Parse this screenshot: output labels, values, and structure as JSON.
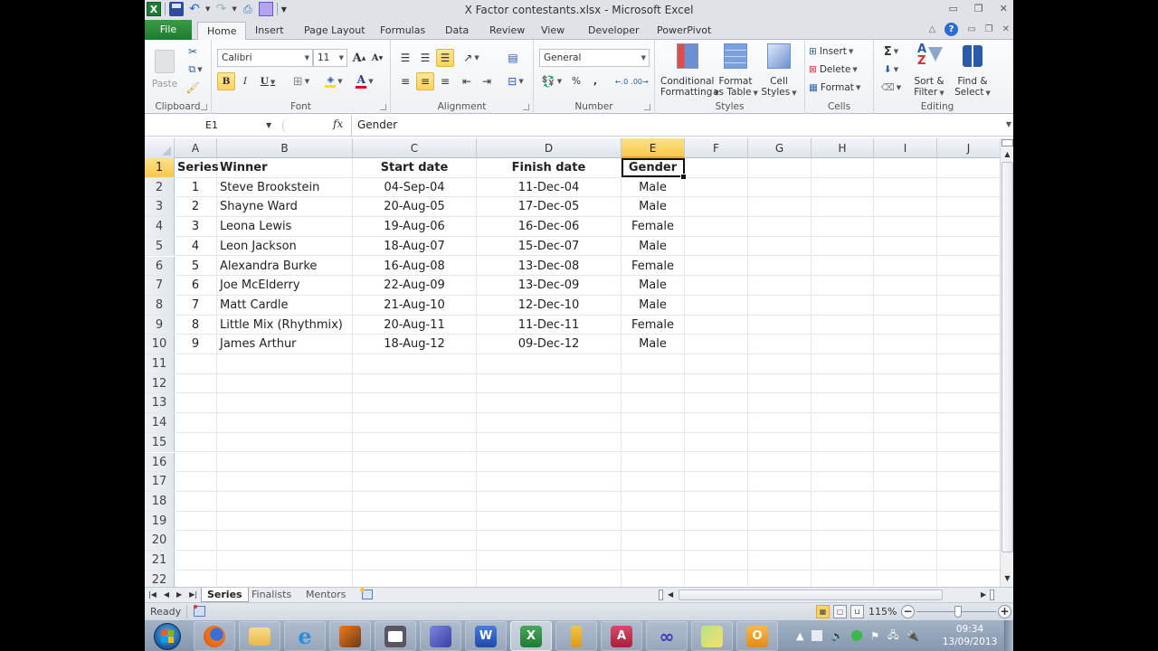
{
  "window": {
    "title": "X Factor contestants.xlsx - Microsoft Excel",
    "controls": {
      "minimize": "▭",
      "restore": "❐",
      "close": "✕"
    }
  },
  "quick_access": {
    "icons": [
      "excel-logo-icon",
      "save-icon",
      "undo-icon",
      "redo-icon",
      "quick-print-icon",
      "purple-square-icon",
      "customize-qat-icon"
    ]
  },
  "ribbon_tabs": [
    {
      "label": "File"
    },
    {
      "label": "Home",
      "active": true
    },
    {
      "label": "Insert"
    },
    {
      "label": "Page Layout"
    },
    {
      "label": "Formulas"
    },
    {
      "label": "Data"
    },
    {
      "label": "Review"
    },
    {
      "label": "View"
    },
    {
      "label": "Developer"
    },
    {
      "label": "PowerPivot"
    }
  ],
  "ribbon": {
    "clipboard": {
      "label": "Clipboard",
      "paste_label": "Paste"
    },
    "font": {
      "label": "Font",
      "font_name": "Calibri",
      "font_size": "11",
      "bold_active": true,
      "fill_color": "#f5e400",
      "font_color": "#e3001b"
    },
    "alignment": {
      "label": "Alignment",
      "bottom_align_active": true,
      "center_active": true
    },
    "number": {
      "label": "Number",
      "format": "General",
      "percent": "%",
      "comma": ","
    },
    "styles": {
      "label": "Styles",
      "conditional_formatting": [
        "Conditional",
        "Formatting"
      ],
      "format_as_table": [
        "Format",
        "as Table"
      ],
      "cell_styles": [
        "Cell",
        "Styles"
      ]
    },
    "cells": {
      "label": "Cells",
      "insert": "Insert",
      "delete": "Delete",
      "format": "Format"
    },
    "editing": {
      "label": "Editing",
      "sigma": "Σ",
      "sort_filter": [
        "Sort &",
        "Filter"
      ],
      "find_select": [
        "Find &",
        "Select"
      ]
    }
  },
  "formula_bar": {
    "name_box": "E1",
    "fx": "fx",
    "value": "Gender"
  },
  "sheet": {
    "columns": [
      "A",
      "B",
      "C",
      "D",
      "E",
      "F",
      "G",
      "H",
      "I",
      "J"
    ],
    "selected_column": "E",
    "selected_row": 1,
    "active_cell": "E1",
    "row_numbers": [
      1,
      2,
      3,
      4,
      5,
      6,
      7,
      8,
      9,
      10,
      11,
      12,
      13,
      14,
      15,
      16,
      17,
      18,
      19,
      20,
      21,
      22
    ],
    "header": {
      "series": "Series",
      "winner": "Winner",
      "start": "Start date",
      "finish": "Finish date",
      "gender": "Gender"
    },
    "rows": [
      {
        "series": "1",
        "winner": "Steve Brookstein",
        "start": "04-Sep-04",
        "finish": "11-Dec-04",
        "gender": "Male"
      },
      {
        "series": "2",
        "winner": "Shayne Ward",
        "start": "20-Aug-05",
        "finish": "17-Dec-05",
        "gender": "Male"
      },
      {
        "series": "3",
        "winner": "Leona Lewis",
        "start": "19-Aug-06",
        "finish": "16-Dec-06",
        "gender": "Female"
      },
      {
        "series": "4",
        "winner": "Leon Jackson",
        "start": "18-Aug-07",
        "finish": "15-Dec-07",
        "gender": "Male"
      },
      {
        "series": "5",
        "winner": "Alexandra Burke",
        "start": "16-Aug-08",
        "finish": "13-Dec-08",
        "gender": "Female"
      },
      {
        "series": "6",
        "winner": "Joe McElderry",
        "start": "22-Aug-09",
        "finish": "13-Dec-09",
        "gender": "Male"
      },
      {
        "series": "7",
        "winner": "Matt Cardle",
        "start": "21-Aug-10",
        "finish": "12-Dec-10",
        "gender": "Male"
      },
      {
        "series": "8",
        "winner": "Little Mix (Rhythmix)",
        "start": "20-Aug-11",
        "finish": "11-Dec-11",
        "gender": "Female"
      },
      {
        "series": "9",
        "winner": "James Arthur",
        "start": "18-Aug-12",
        "finish": "09-Dec-12",
        "gender": "Male"
      }
    ]
  },
  "sheet_tabs": [
    {
      "label": "Series",
      "active": true
    },
    {
      "label": "Finalists"
    },
    {
      "label": "Mentors"
    }
  ],
  "status_bar": {
    "mode": "Ready",
    "zoom": "115%",
    "zoom_percent": 115
  },
  "taskbar": {
    "apps": [
      "windows-start",
      "firefox",
      "file-explorer",
      "internet-explorer",
      "media-player",
      "camera",
      "publisher",
      "word",
      "excel",
      "sql-tool",
      "access",
      "visual-studio",
      "sticky-notes",
      "outlook"
    ],
    "active_app": "excel",
    "clock_time": "09:34",
    "clock_date": "13/09/2013"
  }
}
